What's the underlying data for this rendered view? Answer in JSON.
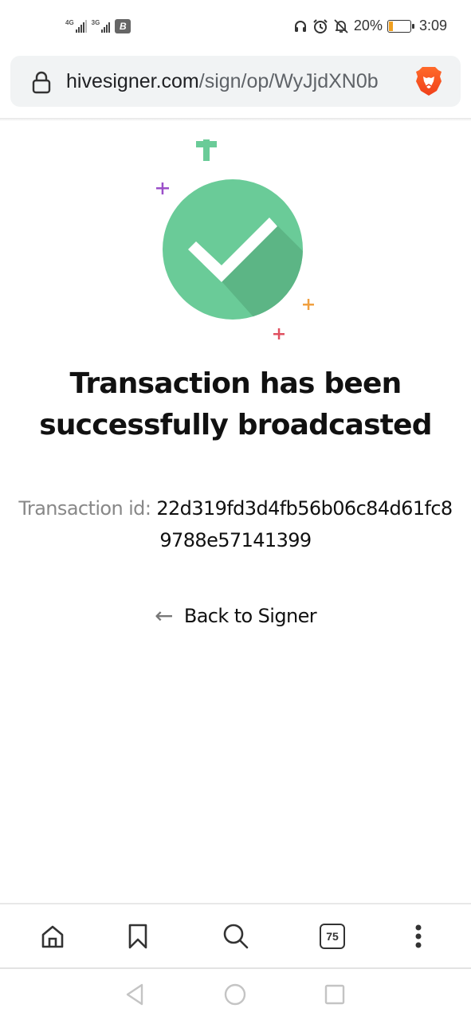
{
  "status_bar": {
    "network1": "4G",
    "network2": "3G",
    "battery_percent": "20%",
    "battery_level": 0.2,
    "time": "3:09",
    "icons": [
      "signal-icon",
      "signal-icon",
      "b-app-icon",
      "headphones-icon",
      "alarm-icon",
      "bell-off-icon",
      "battery-icon"
    ]
  },
  "browser": {
    "url_host": "hivesigner.com",
    "url_path": "/sign/op/WyJjdXN0b",
    "lock_icon": "lock-icon",
    "shield_icon": "brave-lion-icon",
    "tab_count": "75",
    "toolbar": [
      {
        "name": "home",
        "icon": "home-icon"
      },
      {
        "name": "bookmarks",
        "icon": "bookmark-icon"
      },
      {
        "name": "search",
        "icon": "search-icon"
      },
      {
        "name": "tabs",
        "icon": "tabs-icon"
      },
      {
        "name": "menu",
        "icon": "more-vertical-icon"
      }
    ]
  },
  "page": {
    "headline": "Transaction has been successfully broadcasted",
    "txid_label": "Transaction id: ",
    "txid_value": "22d319fd3d4fb56b06c84d61fc89788e57141399",
    "back_link": "Back to Signer",
    "back_arrow": "←",
    "colors": {
      "success": "#6acb98",
      "success_shadow": "#5cb585",
      "sparkle_green": "#6acb98",
      "sparkle_purple": "#9b4fc9",
      "sparkle_orange": "#f0a040",
      "sparkle_red": "#e05060"
    }
  },
  "android_nav": {
    "back": "back-icon",
    "home": "home-circle-icon",
    "recents": "recents-icon"
  }
}
